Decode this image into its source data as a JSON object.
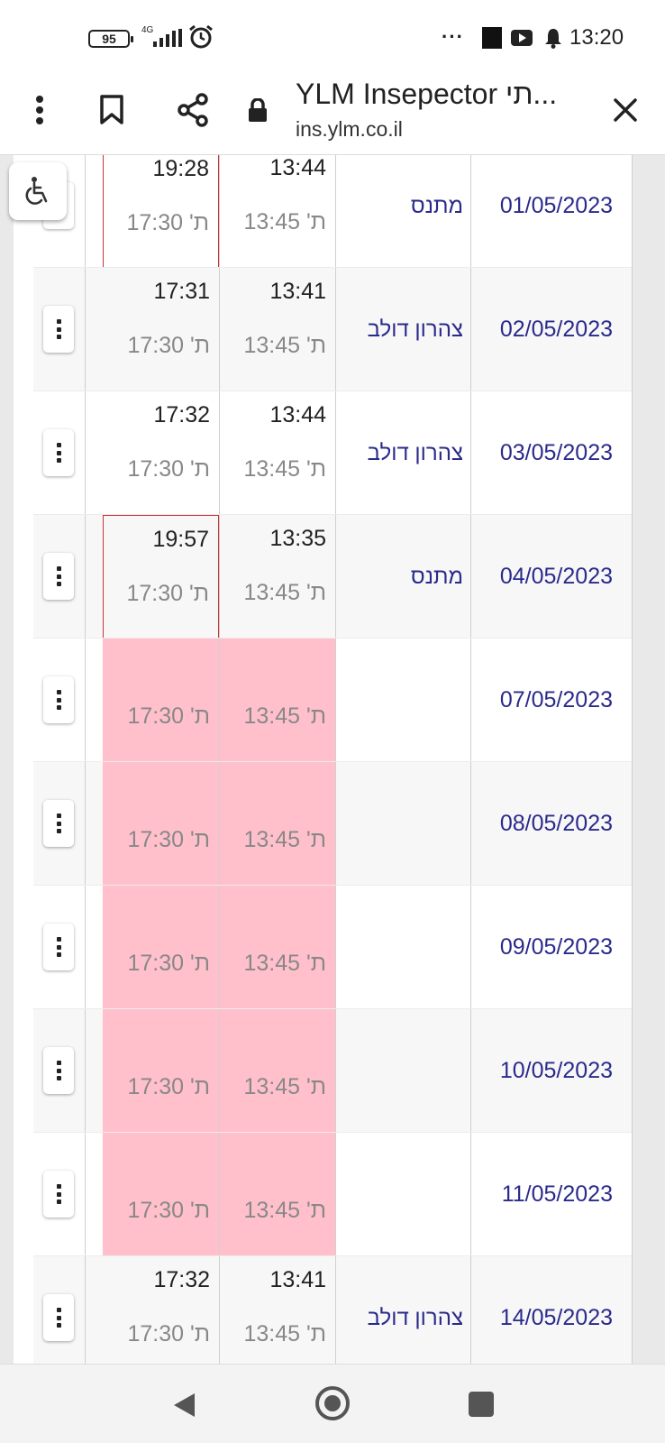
{
  "status_bar": {
    "battery": "95",
    "network": "4G",
    "time": "13:20",
    "more_icon": "more-horizontal-icon"
  },
  "browser": {
    "title": "YLM Insepector תי...",
    "url": "ins.ylm.co.il",
    "icons": [
      "kebab-menu-icon",
      "bookmark-icon",
      "share-icon",
      "lock-icon",
      "close-icon"
    ]
  },
  "accessibility": {
    "icon": "wheelchair-icon"
  },
  "rows": [
    {
      "date": "01/05/2023",
      "place": "מתנס",
      "in_actual": "13:44",
      "in_planned": "ת' 13:45",
      "out_actual": "19:28",
      "out_planned": "ת' 17:30",
      "status": "flag_out"
    },
    {
      "date": "02/05/2023",
      "place": "צהרון דולב",
      "in_actual": "13:41",
      "in_planned": "ת' 13:45",
      "out_actual": "17:31",
      "out_planned": "ת' 17:30",
      "status": "ok"
    },
    {
      "date": "03/05/2023",
      "place": "צהרון דולב",
      "in_actual": "13:44",
      "in_planned": "ת' 13:45",
      "out_actual": "17:32",
      "out_planned": "ת' 17:30",
      "status": "ok"
    },
    {
      "date": "04/05/2023",
      "place": "מתנס",
      "in_actual": "13:35",
      "in_planned": "ת' 13:45",
      "out_actual": "19:57",
      "out_planned": "ת' 17:30",
      "status": "flag_out"
    },
    {
      "date": "07/05/2023",
      "place": "",
      "in_actual": "",
      "in_planned": "ת' 13:45",
      "out_actual": "",
      "out_planned": "ת' 17:30",
      "status": "missing"
    },
    {
      "date": "08/05/2023",
      "place": "",
      "in_actual": "",
      "in_planned": "ת' 13:45",
      "out_actual": "",
      "out_planned": "ת' 17:30",
      "status": "missing"
    },
    {
      "date": "09/05/2023",
      "place": "",
      "in_actual": "",
      "in_planned": "ת' 13:45",
      "out_actual": "",
      "out_planned": "ת' 17:30",
      "status": "missing"
    },
    {
      "date": "10/05/2023",
      "place": "",
      "in_actual": "",
      "in_planned": "ת' 13:45",
      "out_actual": "",
      "out_planned": "ת' 17:30",
      "status": "missing"
    },
    {
      "date": "11/05/2023",
      "place": "",
      "in_actual": "",
      "in_planned": "ת' 13:45",
      "out_actual": "",
      "out_planned": "ת' 17:30",
      "status": "missing"
    },
    {
      "date": "14/05/2023",
      "place": "צהרון דולב",
      "in_actual": "13:41",
      "in_planned": "ת' 13:45",
      "out_actual": "17:32",
      "out_planned": "ת' 17:30",
      "status": "ok"
    }
  ],
  "colors": {
    "missing": "#ffc0cb",
    "flag_border": "#cc3333",
    "link_text": "#2a2a8c"
  },
  "nav": {
    "icons": [
      "back-icon",
      "home-icon",
      "recents-icon"
    ]
  }
}
